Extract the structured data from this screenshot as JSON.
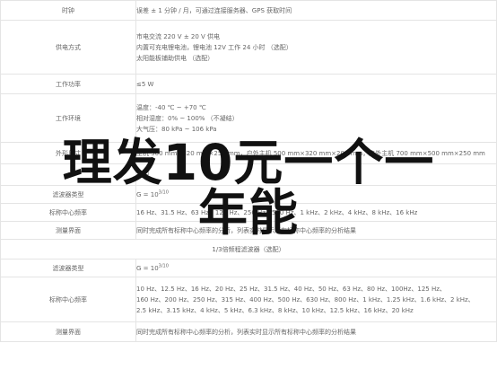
{
  "rows": [
    {
      "label": "时钟",
      "lines": [
        "误差 ± 1 分钟 / 月，可通过连接服务器、GPS 获取时间"
      ]
    },
    {
      "label": "供电方式",
      "lines": [
        "市电交流 220 V ± 20 V 供电",
        "内置可充电锂电池，锂电池 12V 工作 24 小时 （选配）",
        "太阳能板铺助供电 （选配）"
      ]
    },
    {
      "label": "工作功率",
      "lines": [
        "≤5 W"
      ]
    },
    {
      "label": "工作环境",
      "lines": [
        "温度：-40 ℃ ~ +70 ℃",
        "相对湿度：0% ~ 100% （不凝结）",
        "大气压：80 kPa ~ 106 kPa"
      ]
    },
    {
      "label": "外形尺寸",
      "lines": [
        "主机 500 mm×320 mm×250 mm，户外主机 500 mm×320 mm×200 mm，户外主机 700 mm×500 mm×250 mm"
      ]
    },
    {
      "label": "",
      "lines": [
        "选配"
      ]
    }
  ],
  "section1": [
    {
      "label": "滤波器类型",
      "value_prefix": "G = 10",
      "value_sup": "3/10"
    },
    {
      "label": "标称中心频率",
      "lines": [
        "16 Hz、31.5 Hz、63 Hz、125 Hz、250 Hz、500 Hz、1 kHz、2 kHz、4 kHz、8 kHz、16 kHz"
      ]
    },
    {
      "label": "测量界面",
      "lines": [
        "同时完成所有标称中心频率的分析，列表实时显示所有标称中心频率的分析结果"
      ]
    }
  ],
  "section_title": "1/3倍频程滤波器（选配）",
  "section2": [
    {
      "label": "滤波器类型",
      "value_prefix": "G = 10",
      "value_sup": "3/10"
    },
    {
      "label": "标称中心频率",
      "lines": [
        "10 Hz、12.5 Hz、16 Hz、20 Hz、25 Hz、31.5 Hz、40 Hz、50 Hz、63 Hz、80 Hz、100Hz、125 Hz、",
        "160 Hz、200 Hz、250 Hz、315 Hz、400 Hz、500 Hz、630 Hz、800 Hz、1 kHz、1.25 kHz、1.6 kHz、2 kHz、",
        "2.5 kHz、3.15 kHz、4 kHz、5 kHz、6.3 kHz、8 kHz、10 kHz、12.5 kHz、16 kHz、20 kHz"
      ]
    },
    {
      "label": "测量界面",
      "lines": [
        "同时完成所有标称中心频率的分析，列表实时显示所有标称中心频率的分析结果"
      ]
    }
  ],
  "overlay": {
    "line1": "理发10元一个一",
    "line2": "年能"
  }
}
